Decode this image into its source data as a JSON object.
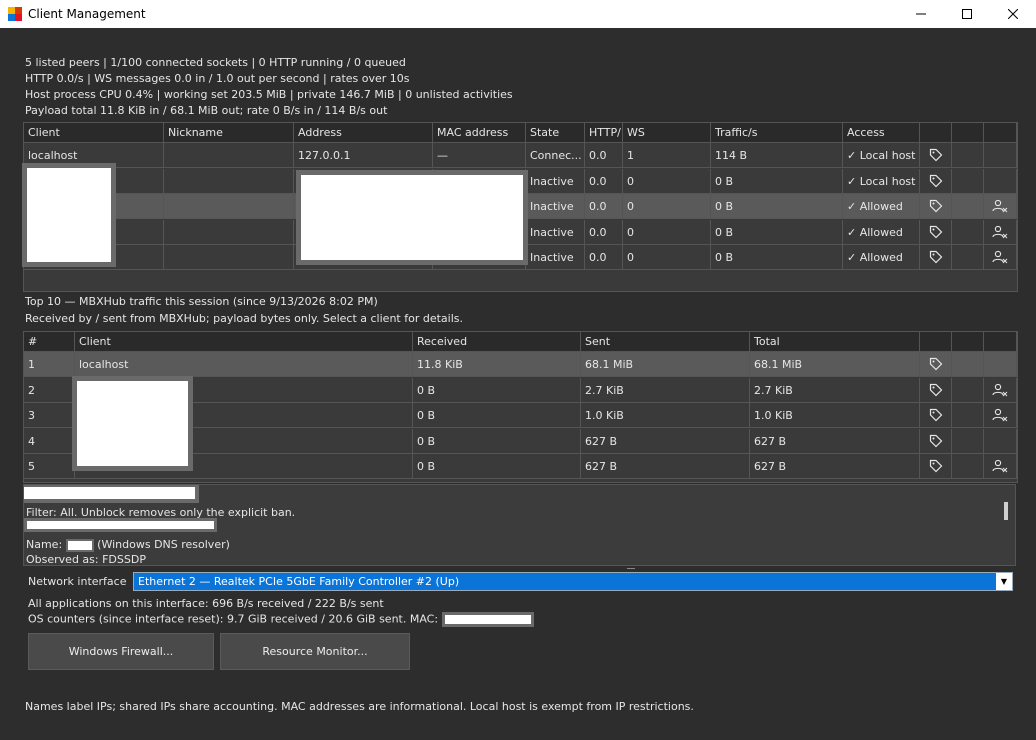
{
  "window": {
    "title": "Client Management"
  },
  "summary": [
    "5 listed peers  |  1/100 connected sockets  |  0 HTTP running / 0 queued",
    "HTTP 0.0/s  |  WS messages 0.0 in / 1.0 out per second  |  rates over 10s",
    "Host process CPU 0.4%  |  working set 203.5 MiB  |  private 146.7 MiB  |  0 unlisted activities",
    "Payload total 11.8 KiB in / 68.1 MiB out; rate 0 B/s in / 114 B/s out"
  ],
  "clients_table": {
    "headers": [
      "Client",
      "Nickname",
      "Address",
      "MAC address",
      "State",
      "HTTP/",
      "WS",
      "Traffic/s",
      "Access"
    ],
    "rows": [
      {
        "client": "localhost",
        "nickname": "",
        "address": "127.0.0.1",
        "mac": "—",
        "state": "Connec...",
        "http": "0.0",
        "ws": "1",
        "traffic": "114 B",
        "access": "✓ Local host",
        "ban": false
      },
      {
        "client": "",
        "nickname": "",
        "address": "",
        "mac": "",
        "state": "Inactive",
        "http": "0.0",
        "ws": "0",
        "traffic": "0 B",
        "access": "✓ Local host",
        "ban": false
      },
      {
        "client": "",
        "nickname": "",
        "address": "",
        "mac": "",
        "state": "Inactive",
        "http": "0.0",
        "ws": "0",
        "traffic": "0 B",
        "access": "✓ Allowed",
        "ban": true
      },
      {
        "client": "",
        "nickname": "",
        "address": "",
        "mac": "",
        "state": "Inactive",
        "http": "0.0",
        "ws": "0",
        "traffic": "0 B",
        "access": "✓ Allowed",
        "ban": true
      },
      {
        "client": "",
        "nickname": "",
        "address": "",
        "mac": "",
        "state": "Inactive",
        "http": "0.0",
        "ws": "0",
        "traffic": "0 B",
        "access": "✓ Allowed",
        "ban": true
      }
    ]
  },
  "top_section": {
    "title": "Top 10 — MBXHub traffic this session (since 9/13/2026 8:02 PM)",
    "subtitle": "Received by / sent from MBXHub; payload bytes only. Select a client for details."
  },
  "top_table": {
    "headers": [
      "#",
      "Client",
      "Received",
      "Sent",
      "Total"
    ],
    "rows": [
      {
        "rank": "1",
        "client": "localhost",
        "received": "11.8 KiB",
        "sent": "68.1 MiB",
        "total": "68.1 MiB",
        "ban": false
      },
      {
        "rank": "2",
        "client": "",
        "received": "0 B",
        "sent": "2.7 KiB",
        "total": "2.7 KiB",
        "ban": true
      },
      {
        "rank": "3",
        "client": "",
        "received": "0 B",
        "sent": "1.0 KiB",
        "total": "1.0 KiB",
        "ban": true
      },
      {
        "rank": "4",
        "client": "",
        "received": "0 B",
        "sent": "627 B",
        "total": "627 B",
        "ban": false
      },
      {
        "rank": "5",
        "client": "",
        "received": "0 B",
        "sent": "627 B",
        "total": "627 B",
        "ban": true
      }
    ]
  },
  "details": {
    "filter_line": "Filter: All. Unblock removes only the explicit ban.",
    "name_prefix": "Name:",
    "name_suffix": "(Windows DNS resolver)",
    "observed": "Observed as: FDSSDP"
  },
  "network": {
    "label": "Network interface",
    "selected": "Ethernet 2 — Realtek PCIe 5GbE Family Controller #2 (Up)",
    "apps_line": "All applications on this interface: 696 B/s received / 222 B/s sent",
    "os_line": "OS counters (since interface reset): 9.7 GiB received / 20.6 GiB sent. MAC:"
  },
  "buttons": {
    "firewall": "Windows Firewall...",
    "resmon": "Resource Monitor..."
  },
  "footer": "Names label IPs; shared IPs share accounting. MAC addresses are informational. Local host is exempt from IP restrictions.",
  "colors": {
    "accent": "#0a74d9",
    "background": "#2d2d2d",
    "selected_row": "#5a5a5a"
  }
}
